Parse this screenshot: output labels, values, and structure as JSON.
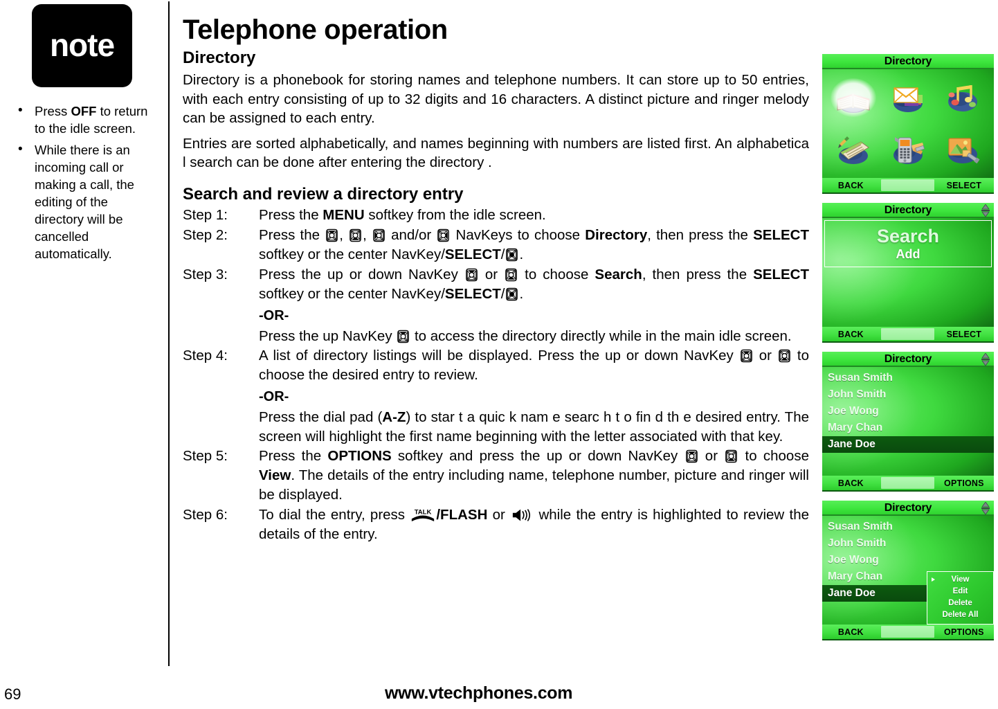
{
  "note": {
    "badge_label": "note",
    "items": [
      {
        "text_before": "Press ",
        "bold": "OFF",
        "text_after": " to return to the idle screen."
      },
      {
        "text_before": "While there is an incoming call or making a call, the editing of the directory will be cancelled automatically.",
        "bold": "",
        "text_after": ""
      }
    ]
  },
  "main": {
    "page_title": "Telephone operation",
    "section_directory": "Directory",
    "para1": "Directory is a phonebook for storing names and telephone numbers. It can store up to  50 entries, with each entry consisting of up to 32 digits and 16 characters. A distinct picture and ringer melody can be assigned to each entry.",
    "para2": "Entries are sorted alphabetically, and names beginning with numbers are listed first. An alphabetica l search can be done after entering the directory .",
    "section_search": "Search and review a directory entry",
    "or_label": "-OR-",
    "steps": [
      {
        "label": "Step 1:"
      },
      {
        "label": "Step 2:"
      },
      {
        "label": "Step 3:"
      },
      {
        "label": "Step 4:"
      },
      {
        "label": "Step 5:"
      },
      {
        "label": "Step 6:"
      }
    ],
    "step1": {
      "a": "Press the ",
      "menu": "MENU",
      "b": " softkey from the idle screen."
    },
    "step2": {
      "a": "Press the ",
      "c1": ", ",
      "c2": ", ",
      "c3": " and/or ",
      "b": " NavKeys to choose ",
      "directory": "Directory",
      "c": ", then press the ",
      "select1": "SELECT",
      "d": " softkey or the center NavKey/",
      "select2": "SELECT",
      "e": "/",
      "f": "."
    },
    "step3": {
      "a": "Press the up or down NavKey ",
      "b": " or ",
      "c": " to choose ",
      "search": "Search",
      "d": ", then press the ",
      "select1": "SELECT",
      "e": " softkey or the center NavKey/",
      "select2": "SELECT",
      "f": "/",
      "g": "."
    },
    "step3_or": {
      "a": "Press the up NavKey ",
      "b": " to access the directory directly while in the main idle screen."
    },
    "step4": {
      "a": "A list of directory listings will be displayed. Press the up or down NavKey ",
      "b": " or ",
      "c": " to choose the desired entry to review."
    },
    "step4_or": {
      "a": "Press the dial pad (",
      "az": "A-Z",
      "b": ") to star t a quic k nam e searc h t o fin d th e desired entry. The screen will highlight the first name beginning with the letter associated with that key."
    },
    "step5": {
      "a": "Press the ",
      "options": "OPTIONS",
      "b": " softkey and press the up or down NavKey ",
      "c": " or ",
      "d": " to choose ",
      "view": "View",
      "e": ". The details of the entry including name, telephone number, picture and ringer will be displayed."
    },
    "step6": {
      "a": "To dial the entry, press ",
      "talk": "TALK",
      "b": "/",
      "flash": "FLASH",
      "c": " or ",
      "d": " while the entry is highlighted to review the details of the entry."
    }
  },
  "screens": {
    "s1": {
      "title": "Directory",
      "softkeys": {
        "left": "BACK",
        "right": "SELECT"
      },
      "icons": [
        {
          "name": "directory-icon",
          "selected": true
        },
        {
          "name": "messages-icon",
          "selected": false
        },
        {
          "name": "ringers-icon",
          "selected": false
        },
        {
          "name": "memo-icon",
          "selected": false
        },
        {
          "name": "handset-settings-icon",
          "selected": false
        },
        {
          "name": "picture-settings-icon",
          "selected": false
        }
      ]
    },
    "s2": {
      "title": "Directory",
      "scroll_indicator": true,
      "highlight": "Search",
      "second": "Add",
      "softkeys": {
        "left": "BACK",
        "right": "SELECT"
      }
    },
    "s3": {
      "title": "Directory",
      "scroll_indicator": true,
      "entries": [
        {
          "name": "Susan Smith",
          "highlighted": false
        },
        {
          "name": "John Smith",
          "highlighted": false
        },
        {
          "name": "Joe Wong",
          "highlighted": false
        },
        {
          "name": "Mary Chan",
          "highlighted": false
        },
        {
          "name": "Jane Doe",
          "highlighted": true
        }
      ],
      "softkeys": {
        "left": "BACK",
        "right": "OPTIONS"
      }
    },
    "s4": {
      "title": "Directory",
      "scroll_indicator": true,
      "entries": [
        {
          "name": "Susan Smith",
          "highlighted": false
        },
        {
          "name": "John Smith",
          "highlighted": false
        },
        {
          "name": "Joe Wong",
          "highlighted": false
        },
        {
          "name": "Mary Chan",
          "highlighted": false
        },
        {
          "name": "Jane Doe",
          "highlighted": true
        }
      ],
      "popup": [
        {
          "label": "View",
          "selected": true
        },
        {
          "label": "Edit",
          "selected": false
        },
        {
          "label": "Delete",
          "selected": false
        },
        {
          "label": "Delete All",
          "selected": false
        }
      ],
      "softkeys": {
        "left": "BACK",
        "right": "OPTIONS"
      }
    }
  },
  "footer": {
    "page_number": "69",
    "website": "www.vtechphones.com"
  },
  "colors": {
    "screen_green_light": "#57ef57",
    "screen_green_mid": "#3fd93f",
    "screen_green_dark": "#0d5c10",
    "highlight_row": "#0c5a0f",
    "note_badge_bg": "#000000"
  }
}
